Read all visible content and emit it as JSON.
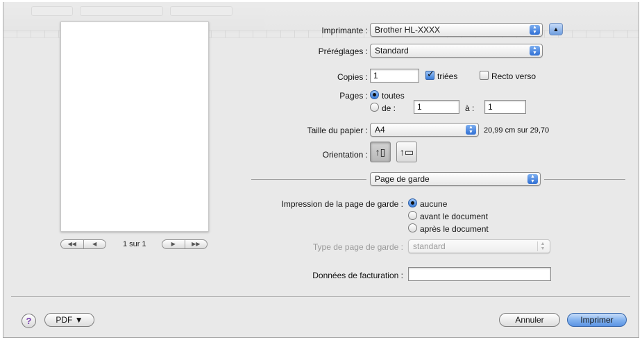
{
  "printer": {
    "label": "Imprimante :",
    "value": "Brother HL-XXXX",
    "toggle_icon": "triangle-up-icon"
  },
  "presets": {
    "label": "Préréglages :",
    "value": "Standard"
  },
  "copies": {
    "label": "Copies :",
    "value": "1",
    "collated_label": "triées",
    "collated": true,
    "duplex_label": "Recto verso",
    "duplex": false
  },
  "pages": {
    "label": "Pages :",
    "all_label": "toutes",
    "range_label": "de :",
    "from": "1",
    "to_label": "à :",
    "to": "1",
    "selected": "all"
  },
  "paper": {
    "label": "Taille du papier :",
    "value": "A4",
    "dimensions": "20,99 cm sur 29,70"
  },
  "orientation": {
    "label": "Orientation :",
    "portrait_icon": "portrait-orientation-icon",
    "landscape_icon": "landscape-orientation-icon",
    "selected": "portrait"
  },
  "panel": {
    "value": "Page de garde"
  },
  "cover": {
    "label": "Impression de la page de garde :",
    "options": [
      "aucune",
      "avant le document",
      "après le document"
    ],
    "selected": 0,
    "type_label": "Type de page de garde :",
    "type_value": "standard"
  },
  "billing": {
    "label": "Données de facturation :",
    "value": ""
  },
  "preview": {
    "page_text": "1 sur 1"
  },
  "footer": {
    "help": "?",
    "pdf": "PDF ▼",
    "cancel": "Annuler",
    "print": "Imprimer"
  },
  "colors": {
    "accent": "#3a7ddb",
    "background": "#e9e9e9"
  }
}
